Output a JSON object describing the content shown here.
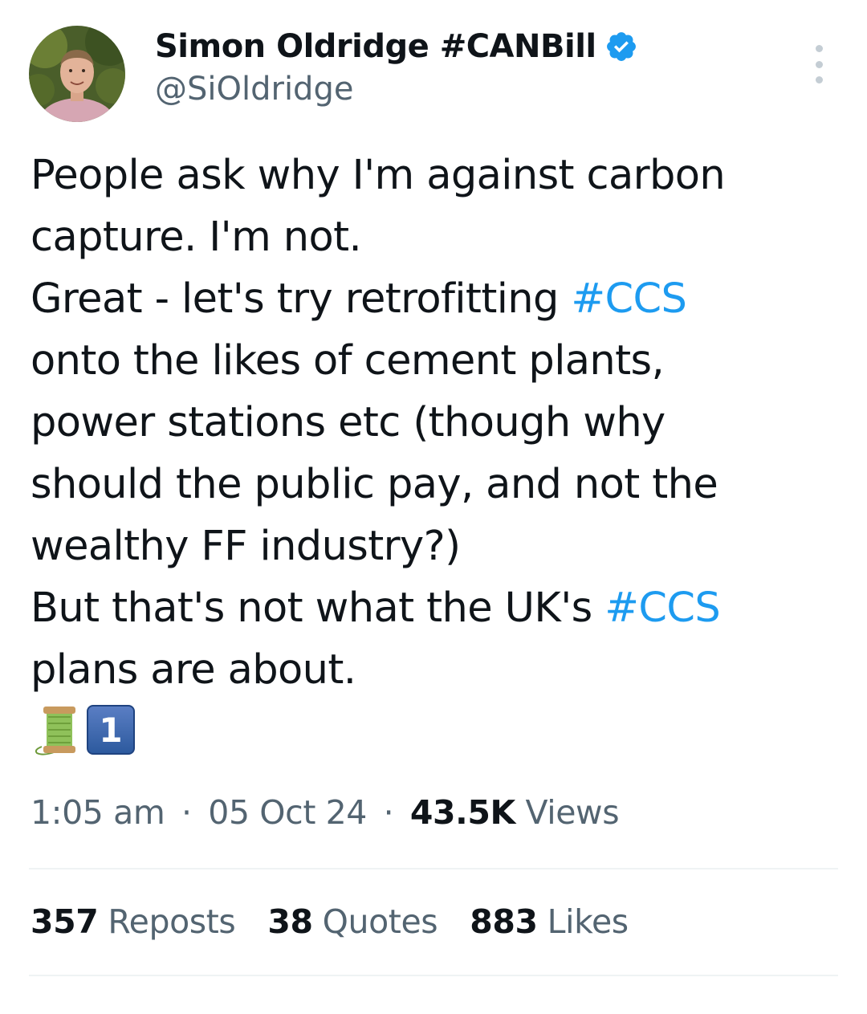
{
  "author": {
    "display_name": "Simon Oldridge #CANBill",
    "handle": "@SiOldridge",
    "verified_icon": "verified-badge-icon",
    "verified_color": "#1d9bf0"
  },
  "tweet": {
    "lines": [
      [
        {
          "text": "People ask why I'm against carbon"
        }
      ],
      [
        {
          "text": "capture. I'm not."
        }
      ],
      [
        {
          "text": "Great - let's try retrofitting "
        },
        {
          "text": "#CCS",
          "hashtag": true
        }
      ],
      [
        {
          "text": "onto the likes of cement plants,"
        }
      ],
      [
        {
          "text": "power stations etc (though why"
        }
      ],
      [
        {
          "text": "should the public pay, and not the"
        }
      ],
      [
        {
          "text": "wealthy FF industry?)"
        }
      ],
      [
        {
          "text": "But that's not what the UK's "
        },
        {
          "text": "#CCS",
          "hashtag": true
        }
      ],
      [
        {
          "text": "plans are about."
        }
      ]
    ],
    "emojis": {
      "thread_icon": "spool-of-thread-icon",
      "keycap": "1"
    }
  },
  "meta": {
    "time": "1:05 am",
    "separator": "·",
    "date": "05 Oct 24",
    "views_count": "43.5K",
    "views_label": "Views"
  },
  "stats": {
    "reposts_count": "357",
    "reposts_label": "Reposts",
    "quotes_count": "38",
    "quotes_label": "Quotes",
    "likes_count": "883",
    "likes_label": "Likes"
  },
  "colors": {
    "text": "#0f1419",
    "secondary": "#536471",
    "accent": "#1d9bf0",
    "divider": "#eff3f4"
  }
}
